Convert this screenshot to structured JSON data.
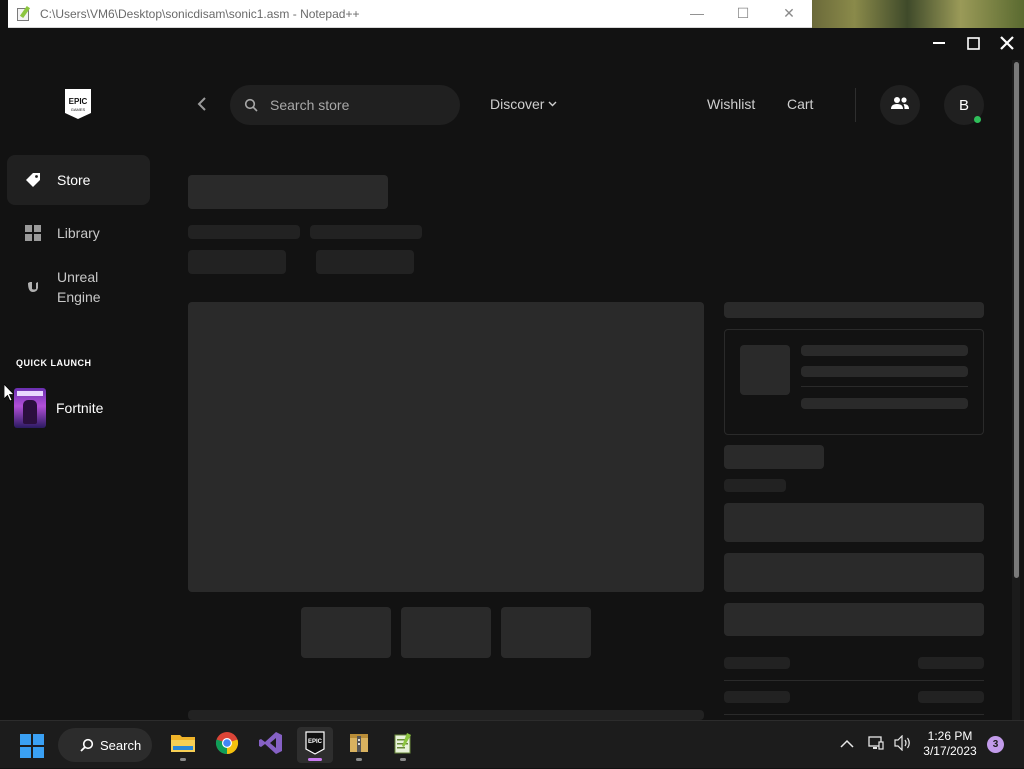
{
  "notepad": {
    "title": "C:\\Users\\VM6\\Desktop\\sonicdisam\\sonic1.asm - Notepad++",
    "min": "—",
    "max": "☐",
    "close": "✕"
  },
  "epic": {
    "window": {
      "min": "—",
      "max": "☐",
      "close": "✕"
    },
    "sidebar": {
      "items": [
        {
          "label": "Store",
          "icon": "tag-icon"
        },
        {
          "label": "Library",
          "icon": "grid-icon"
        },
        {
          "label": "Unreal\nEngine",
          "icon": "unreal-icon"
        }
      ],
      "quick_launch_title": "QUICK LAUNCH",
      "quick_launch": [
        {
          "label": "Fortnite"
        }
      ]
    },
    "topbar": {
      "back": "‹",
      "search_placeholder": "Search store",
      "discover": "Discover",
      "wishlist": "Wishlist",
      "cart": "Cart",
      "avatar_initial": "B"
    }
  },
  "taskbar": {
    "search_label": "Search",
    "time": "1:26 PM",
    "date": "3/17/2023",
    "notifications": "3"
  },
  "colors": {
    "accent_active": "#c87af0",
    "online": "#2fbf5a",
    "start": "#3aa0f3"
  }
}
